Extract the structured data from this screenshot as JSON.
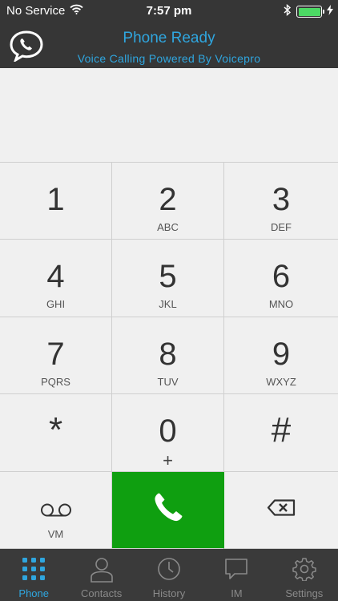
{
  "status_bar": {
    "carrier": "No Service",
    "time": "7:57 pm",
    "battery_level": 1.0,
    "icons": [
      "wifi-icon",
      "bluetooth-icon",
      "battery-icon",
      "charging-icon"
    ]
  },
  "header": {
    "title": "Phone Ready",
    "subtitle": "Voice Calling Powered By Voicepro",
    "logo_icon": "phone-chat-bubble-icon"
  },
  "colors": {
    "accent": "#2fa6df",
    "call_button": "#0f9f10",
    "header_bg": "#363636",
    "tabbar_bg": "#3a3a3a",
    "battery": "#4cd964"
  },
  "keypad": {
    "keys": [
      {
        "digit": "1",
        "letters": ""
      },
      {
        "digit": "2",
        "letters": "ABC"
      },
      {
        "digit": "3",
        "letters": "DEF"
      },
      {
        "digit": "4",
        "letters": "GHI"
      },
      {
        "digit": "5",
        "letters": "JKL"
      },
      {
        "digit": "6",
        "letters": "MNO"
      },
      {
        "digit": "7",
        "letters": "PQRS"
      },
      {
        "digit": "8",
        "letters": "TUV"
      },
      {
        "digit": "9",
        "letters": "WXYZ"
      },
      {
        "digit": "*",
        "letters": ""
      },
      {
        "digit": "0",
        "letters": "+"
      },
      {
        "digit": "#",
        "letters": ""
      }
    ],
    "voicemail_label": "VM",
    "voicemail_icon": "voicemail-icon",
    "call_icon": "phone-handset-icon",
    "backspace_icon": "backspace-icon"
  },
  "tabs": [
    {
      "label": "Phone",
      "icon": "dialpad-icon",
      "active": true
    },
    {
      "label": "Contacts",
      "icon": "person-icon",
      "active": false
    },
    {
      "label": "History",
      "icon": "clock-icon",
      "active": false
    },
    {
      "label": "IM",
      "icon": "chat-bubble-icon",
      "active": false
    },
    {
      "label": "Settings",
      "icon": "gear-icon",
      "active": false
    }
  ]
}
